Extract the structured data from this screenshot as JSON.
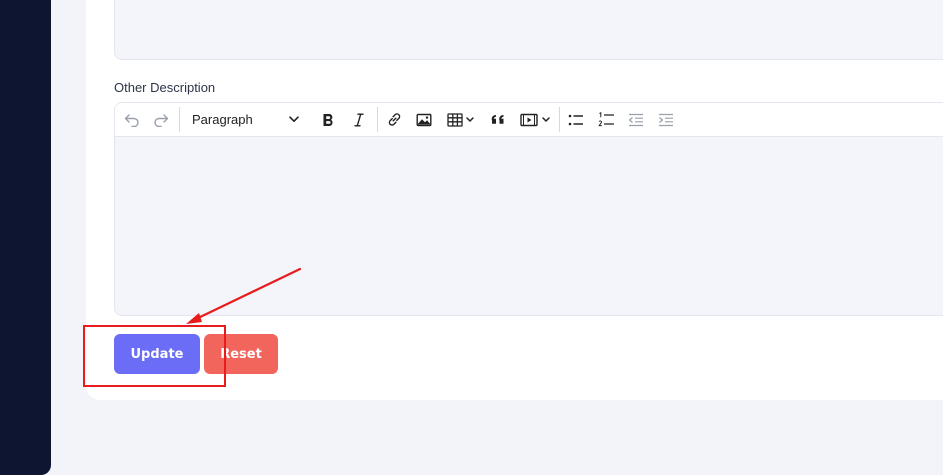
{
  "form": {
    "other_description_label": "Other Description"
  },
  "editor": {
    "block_format": "Paragraph",
    "tools": [
      "undo-icon",
      "redo-icon",
      "bold-icon",
      "italic-icon",
      "link-icon",
      "image-icon",
      "table-icon",
      "blockquote-icon",
      "media-icon",
      "bulleted-list-icon",
      "numbered-list-icon",
      "outdent-icon",
      "indent-icon"
    ]
  },
  "buttons": {
    "update_label": "Update",
    "reset_label": "Reset"
  },
  "colors": {
    "sidebar": "#0d1530",
    "update_button": "#6c6df7",
    "reset_button": "#f2655d",
    "annotation": "#e81c1c"
  }
}
